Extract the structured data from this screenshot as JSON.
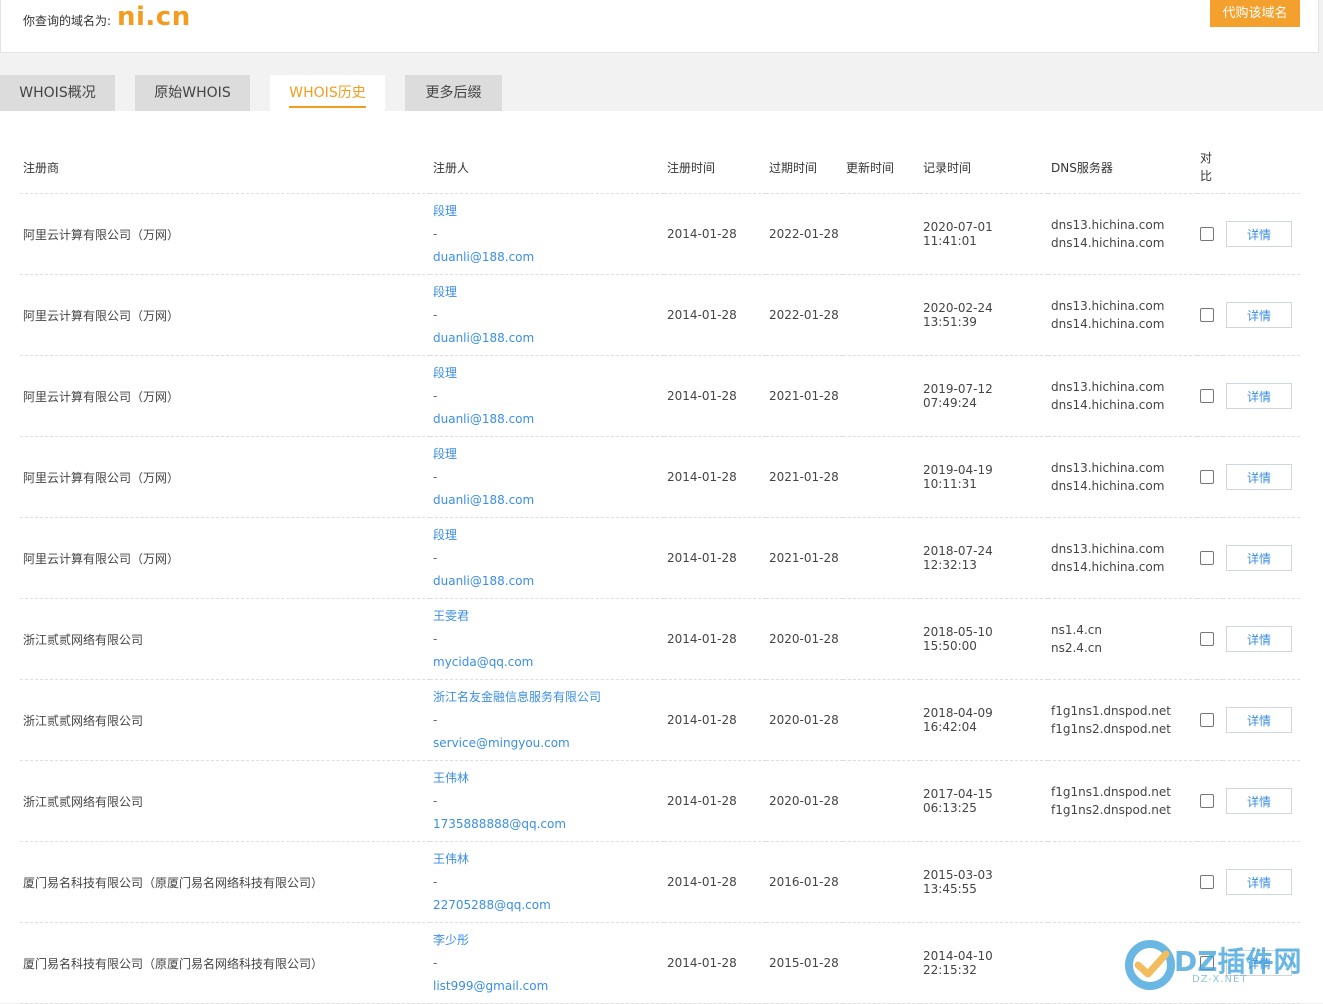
{
  "header": {
    "query_label": "你查询的域名为:",
    "domain": "ni.cn",
    "buy_label": "代购该域名"
  },
  "tabs": [
    {
      "label": "WHOIS概况",
      "active": false
    },
    {
      "label": "原始WHOIS",
      "active": false
    },
    {
      "label": "WHOIS历史",
      "active": true
    },
    {
      "label": "更多后缀",
      "active": false
    }
  ],
  "table": {
    "columns": [
      "注册商",
      "注册人",
      "注册时间",
      "过期时间",
      "更新时间",
      "记录时间",
      "DNS服务器",
      "对比"
    ],
    "detail_label": "详情",
    "rows": [
      {
        "registrar": "阿里云计算有限公司（万网）",
        "name": "段理",
        "sep": "-",
        "email": "duanli@188.com",
        "reg_date": "2014-01-28",
        "exp_date": "2022-01-28",
        "upd_date": "",
        "rec_time": "2020-07-01 11:41:01",
        "dns1": "dns13.hichina.com",
        "dns2": "dns14.hichina.com"
      },
      {
        "registrar": "阿里云计算有限公司（万网）",
        "name": "段理",
        "sep": "-",
        "email": "duanli@188.com",
        "reg_date": "2014-01-28",
        "exp_date": "2022-01-28",
        "upd_date": "",
        "rec_time": "2020-02-24 13:51:39",
        "dns1": "dns13.hichina.com",
        "dns2": "dns14.hichina.com"
      },
      {
        "registrar": "阿里云计算有限公司（万网）",
        "name": "段理",
        "sep": "-",
        "email": "duanli@188.com",
        "reg_date": "2014-01-28",
        "exp_date": "2021-01-28",
        "upd_date": "",
        "rec_time": "2019-07-12 07:49:24",
        "dns1": "dns13.hichina.com",
        "dns2": "dns14.hichina.com"
      },
      {
        "registrar": "阿里云计算有限公司（万网）",
        "name": "段理",
        "sep": "-",
        "email": "duanli@188.com",
        "reg_date": "2014-01-28",
        "exp_date": "2021-01-28",
        "upd_date": "",
        "rec_time": "2019-04-19 10:11:31",
        "dns1": "dns13.hichina.com",
        "dns2": "dns14.hichina.com"
      },
      {
        "registrar": "阿里云计算有限公司（万网）",
        "name": "段理",
        "sep": "-",
        "email": "duanli@188.com",
        "reg_date": "2014-01-28",
        "exp_date": "2021-01-28",
        "upd_date": "",
        "rec_time": "2018-07-24 12:32:13",
        "dns1": "dns13.hichina.com",
        "dns2": "dns14.hichina.com"
      },
      {
        "registrar": "浙江贰贰网络有限公司",
        "name": "王雯君",
        "sep": "-",
        "email": "mycida@qq.com",
        "reg_date": "2014-01-28",
        "exp_date": "2020-01-28",
        "upd_date": "",
        "rec_time": "2018-05-10 15:50:00",
        "dns1": "ns1.4.cn",
        "dns2": "ns2.4.cn"
      },
      {
        "registrar": "浙江贰贰网络有限公司",
        "name": "浙江名友金融信息服务有限公司",
        "sep": "-",
        "email": "service@mingyou.com",
        "reg_date": "2014-01-28",
        "exp_date": "2020-01-28",
        "upd_date": "",
        "rec_time": "2018-04-09 16:42:04",
        "dns1": "f1g1ns1.dnspod.net",
        "dns2": "f1g1ns2.dnspod.net"
      },
      {
        "registrar": "浙江贰贰网络有限公司",
        "name": "王伟林",
        "sep": "-",
        "email": "1735888888@qq.com",
        "reg_date": "2014-01-28",
        "exp_date": "2020-01-28",
        "upd_date": "",
        "rec_time": "2017-04-15 06:13:25",
        "dns1": "f1g1ns1.dnspod.net",
        "dns2": "f1g1ns2.dnspod.net"
      },
      {
        "registrar": "厦门易名科技有限公司（原厦门易名网络科技有限公司）",
        "name": "王伟林",
        "sep": "-",
        "email": "22705288@qq.com",
        "reg_date": "2014-01-28",
        "exp_date": "2016-01-28",
        "upd_date": "",
        "rec_time": "2015-03-03 13:45:55",
        "dns1": "",
        "dns2": ""
      },
      {
        "registrar": "厦门易名科技有限公司（原厦门易名网络科技有限公司）",
        "name": "李少彤",
        "sep": "-",
        "email": "list999@gmail.com",
        "reg_date": "2014-01-28",
        "exp_date": "2015-01-28",
        "upd_date": "",
        "rec_time": "2014-04-10 22:15:32",
        "dns1": "",
        "dns2": ""
      }
    ]
  },
  "watermark": {
    "text": "DZ插件网",
    "sub": "DZ-X.NET",
    "color": "#3aa0dc"
  }
}
